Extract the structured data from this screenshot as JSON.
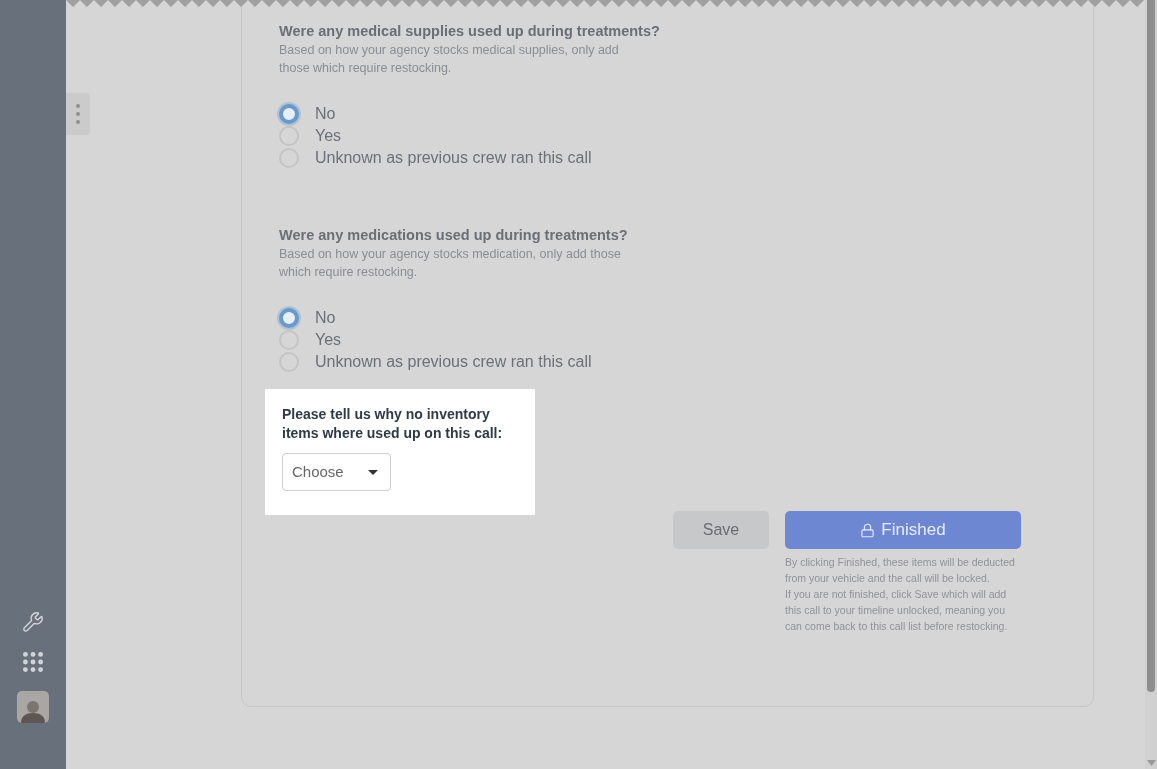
{
  "questions": [
    {
      "title": "Were any medical supplies used up during treatments?",
      "hint": "Based on how your agency stocks medical supplies, only add those which require restocking.",
      "options": [
        {
          "label": "No",
          "selected": true
        },
        {
          "label": "Yes",
          "selected": false
        },
        {
          "label": "Unknown as previous crew ran this call",
          "selected": false
        }
      ]
    },
    {
      "title": "Were any medications used up during treatments?",
      "hint": "Based on how your agency stocks medication, only add those which require restocking.",
      "options": [
        {
          "label": "No",
          "selected": true
        },
        {
          "label": "Yes",
          "selected": false
        },
        {
          "label": "Unknown as previous crew ran this call",
          "selected": false
        }
      ]
    }
  ],
  "reason": {
    "label": "Please tell us why no inventory items where used up on this call:",
    "select": {
      "value": "Choose"
    }
  },
  "buttons": {
    "save": "Save",
    "finished": "Finished"
  },
  "notes": [
    "By clicking Finished, these items will be deducted from your vehicle and the call will be locked.",
    "If you are not finished, click Save which will add this call to your timeline unlocked, meaning you can come back to this call list before restocking."
  ]
}
